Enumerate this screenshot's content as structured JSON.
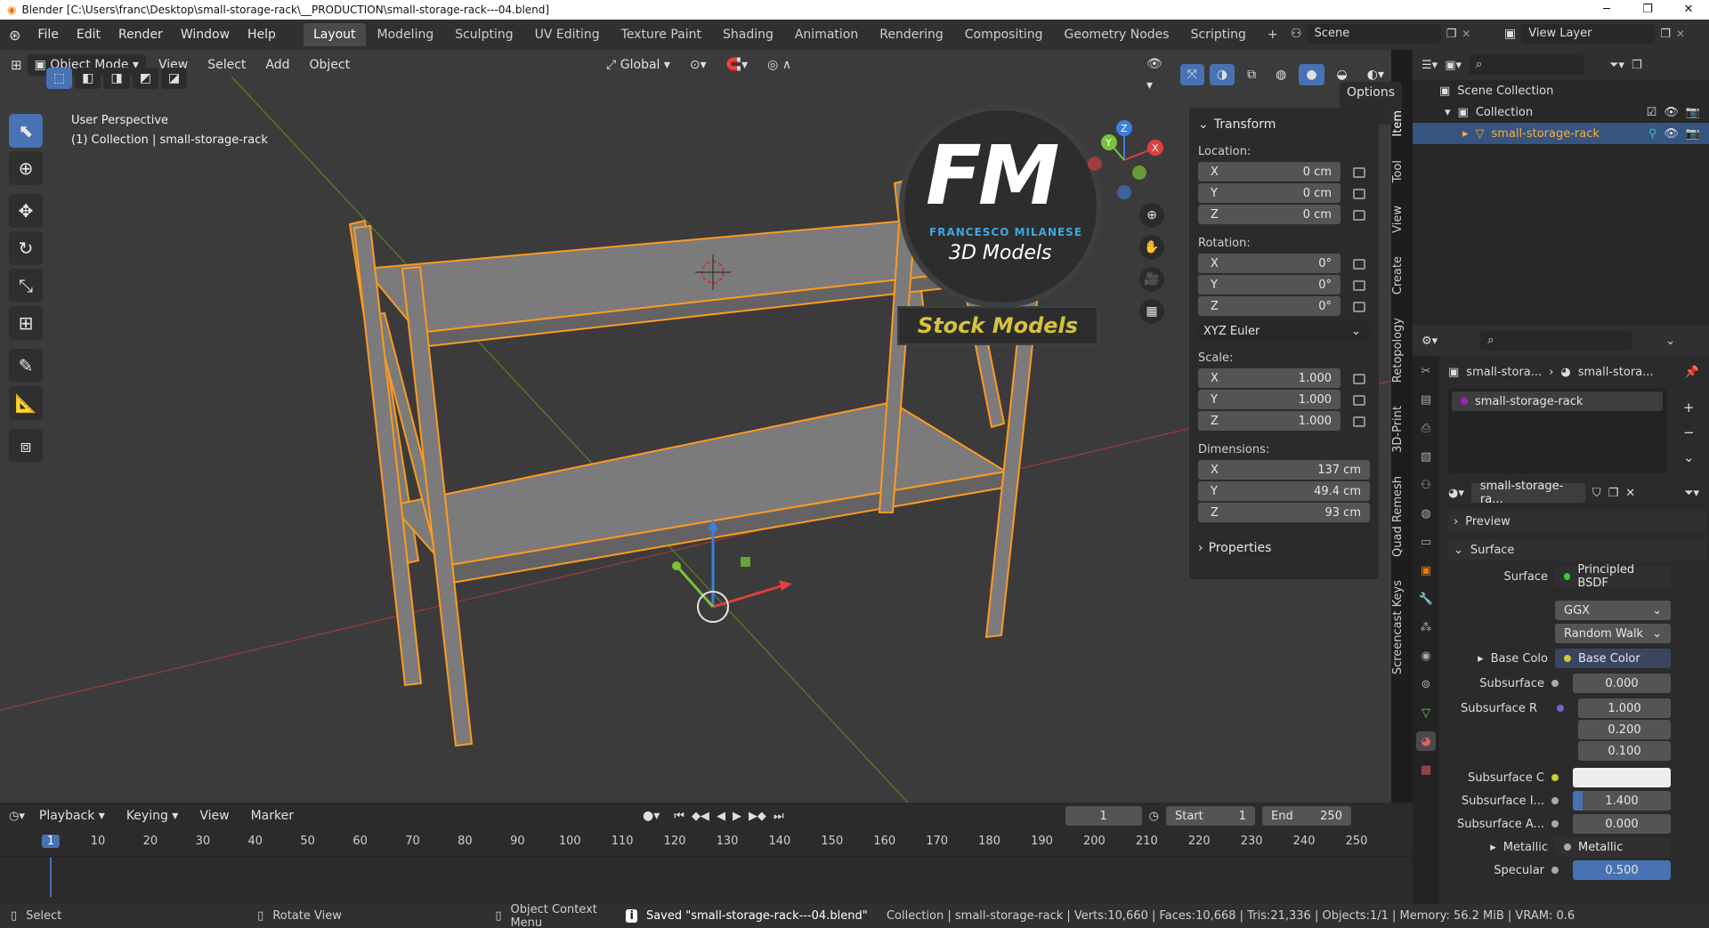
{
  "window": {
    "title": "Blender [C:\\Users\\franc\\Desktop\\small-storage-rack\\__PRODUCTION\\small-storage-rack---04.blend]",
    "min": "─",
    "max": "❐",
    "close": "✕"
  },
  "menu": [
    "File",
    "Edit",
    "Render",
    "Window",
    "Help"
  ],
  "workspaces": [
    "Layout",
    "Modeling",
    "Sculpting",
    "UV Editing",
    "Texture Paint",
    "Shading",
    "Animation",
    "Rendering",
    "Compositing",
    "Geometry Nodes",
    "Scripting"
  ],
  "active_workspace": "Layout",
  "add_workspace": "+",
  "scene": "Scene",
  "view_layer": "View Layer",
  "viewport": {
    "mode": "Object Mode",
    "menus": [
      "View",
      "Select",
      "Add",
      "Object"
    ],
    "orientation": "Global",
    "options": "Options",
    "perspective": "User Perspective",
    "collection_info": "(1) Collection | small-storage-rack",
    "gizmo_axes": [
      "X",
      "Y",
      "Z"
    ]
  },
  "watermark": {
    "logo": "FM",
    "maker": "FRANCESCO MILANESE",
    "sub": "3D Models",
    "stock": "Stock Models"
  },
  "npanel": {
    "transform": "Transform",
    "location_label": "Location:",
    "location": [
      {
        "axis": "X",
        "value": "0 cm"
      },
      {
        "axis": "Y",
        "value": "0 cm"
      },
      {
        "axis": "Z",
        "value": "0 cm"
      }
    ],
    "rotation_label": "Rotation:",
    "rotation": [
      {
        "axis": "X",
        "value": "0°"
      },
      {
        "axis": "Y",
        "value": "0°"
      },
      {
        "axis": "Z",
        "value": "0°"
      }
    ],
    "rotation_mode": "XYZ Euler",
    "scale_label": "Scale:",
    "scale": [
      {
        "axis": "X",
        "value": "1.000"
      },
      {
        "axis": "Y",
        "value": "1.000"
      },
      {
        "axis": "Z",
        "value": "1.000"
      }
    ],
    "dimensions_label": "Dimensions:",
    "dimensions": [
      {
        "axis": "X",
        "value": "137 cm"
      },
      {
        "axis": "Y",
        "value": "49.4 cm"
      },
      {
        "axis": "Z",
        "value": "93 cm"
      }
    ],
    "properties": "Properties"
  },
  "side_tabs": [
    "Item",
    "Tool",
    "View",
    "Create",
    "Retopology",
    "3D-Print",
    "Quad Remesh",
    "Screencast Keys"
  ],
  "outliner": {
    "scene_collection": "Scene Collection",
    "collection": "Collection",
    "object": "small-storage-rack"
  },
  "properties": {
    "breadcrumb_obj": "small-stora...",
    "breadcrumb_mat": "small-stora...",
    "material_slot": "small-storage-rack",
    "material_name": "small-storage-ra...",
    "preview": "Preview",
    "surface_header": "Surface",
    "surface_label": "Surface",
    "surface_value": "Principled BSDF",
    "distribution": "GGX",
    "subsurface_method": "Random Walk",
    "base_color_label": "Base Colo",
    "base_color_value": "Base Color",
    "subsurface_label": "Subsurface",
    "subsurface_value": "0.000",
    "subsurface_radius_label": "Subsurface R",
    "subsurface_radius": [
      "1.000",
      "0.200",
      "0.100"
    ],
    "subsurface_color_label": "Subsurface C",
    "subsurface_ior_label": "Subsurface I...",
    "subsurface_ior_value": "1.400",
    "subsurface_aniso_label": "Subsurface A...",
    "subsurface_aniso_value": "0.000",
    "metallic_label": "Metallic",
    "metallic_value": "Metallic",
    "specular_label": "Specular",
    "specular_value": "0.500"
  },
  "timeline": {
    "menus": [
      "Playback",
      "Keying",
      "View",
      "Marker"
    ],
    "current_frame": "1",
    "start_label": "Start",
    "start": "1",
    "end_label": "End",
    "end": "250",
    "ticks": [
      "1",
      "10",
      "20",
      "30",
      "40",
      "50",
      "60",
      "70",
      "80",
      "90",
      "100",
      "110",
      "120",
      "130",
      "140",
      "150",
      "160",
      "170",
      "180",
      "190",
      "200",
      "210",
      "220",
      "230",
      "240",
      "250"
    ]
  },
  "status": {
    "select": "Select",
    "rotate": "Rotate View",
    "context": "Object Context Menu",
    "saved": "Saved \"small-storage-rack---04.blend\"",
    "stats": "Collection | small-storage-rack | Verts:10,660 | Faces:10,668 | Tris:21,336 | Objects:1/1 | Memory: 56.2 MiB | VRAM: 0.6"
  },
  "colors": {
    "accent": "#4772b3",
    "selection": "#ffaf29",
    "header": "#303030",
    "viewport": "#3b3b3b"
  }
}
